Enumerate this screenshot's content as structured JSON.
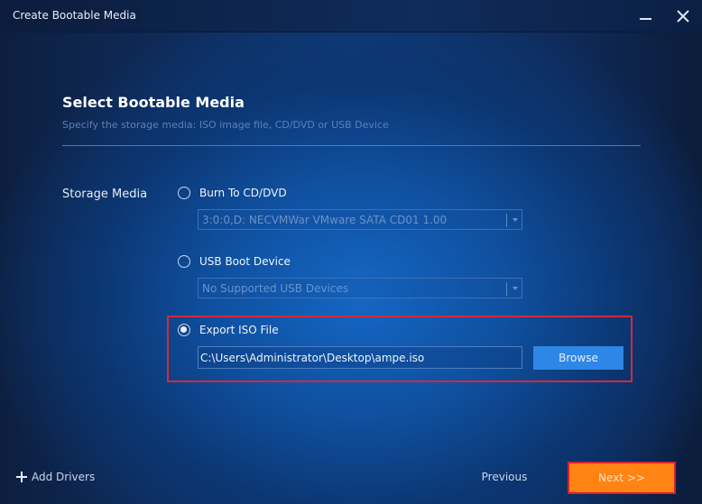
{
  "window": {
    "title": "Create Bootable Media",
    "minimize_label": "Minimize",
    "close_label": "Close"
  },
  "header": {
    "title": "Select Bootable Media",
    "subtitle": "Specify the storage media: ISO image file, CD/DVD or USB Device"
  },
  "storage": {
    "label": "Storage Media",
    "options": [
      {
        "label": "Burn To CD/DVD",
        "checked": false,
        "select_value": "3:0:0,D: NECVMWar VMware SATA CD01 1.00"
      },
      {
        "label": "USB Boot Device",
        "checked": false,
        "select_value": "No Supported USB Devices"
      },
      {
        "label": "Export ISO File",
        "checked": true,
        "path_value": "C:\\Users\\Administrator\\Desktop\\ampe.iso"
      }
    ],
    "browse_label": "Browse"
  },
  "footer": {
    "add_drivers_label": "Add Drivers",
    "previous_label": "Previous",
    "next_label": "Next >>"
  },
  "colors": {
    "accent_orange": "#ff8413",
    "browse_blue": "#2e87e6",
    "highlight_red": "#d02a3c"
  }
}
